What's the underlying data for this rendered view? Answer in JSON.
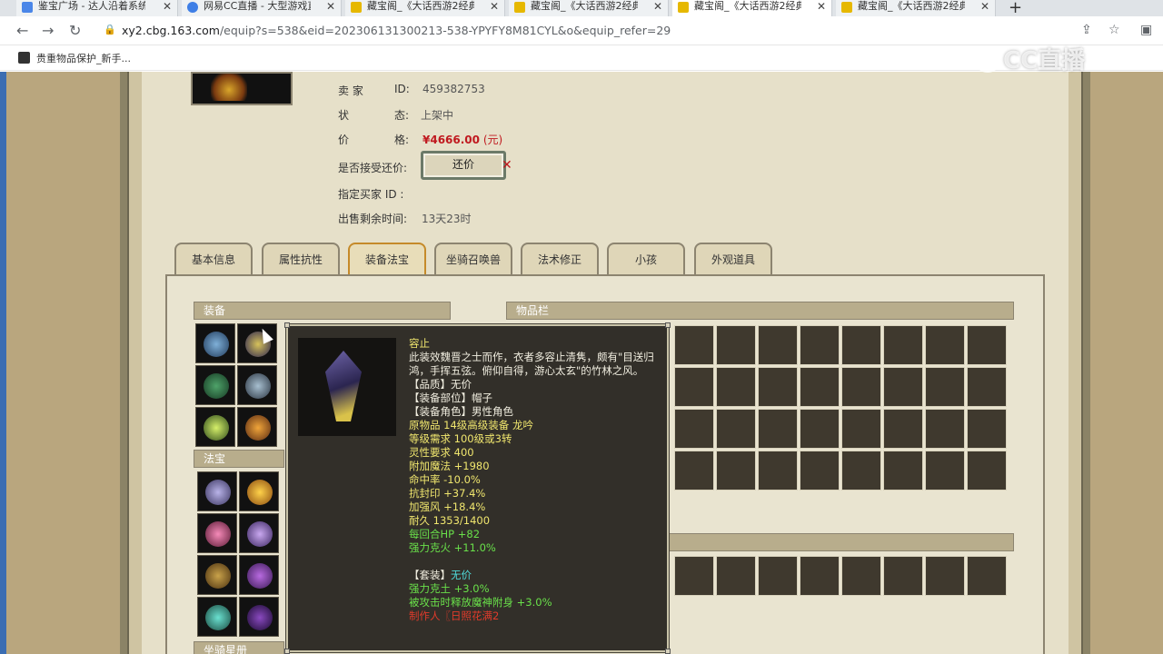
{
  "browser": {
    "tabs": [
      {
        "title": "鉴宝广场 - 达人沿着系统",
        "icon_color": "#4a86e8"
      },
      {
        "title": "网易CC直播 - 大型游戏直播",
        "icon_color": "#3f7fe6"
      },
      {
        "title": "藏宝阁_《大话西游2经典",
        "icon_color": "#e6b800"
      },
      {
        "title": "藏宝阁_《大话西游2经典",
        "icon_color": "#e6b800"
      },
      {
        "title": "藏宝阁_《大话西游2经典",
        "icon_color": "#e6b800"
      },
      {
        "title": "藏宝阁_《大话西游2经典",
        "icon_color": "#e6b800"
      }
    ],
    "active_tab": 4,
    "url_main": "xy2.cbg.163.com",
    "url_rest": "/equip?s=538&eid=202306131300213-538-YPYFY8M81CYL&o&equip_refer=29",
    "bookmark": "贵重物品保护_新手..."
  },
  "watermark": "CC直播",
  "seller": {
    "seller_label": "卖  家",
    "id_label": "ID:",
    "id_value": "459382753",
    "status_label": "状",
    "status_label2": "态:",
    "status_value": "上架中",
    "price_label": "价",
    "price_label2": "格:",
    "price_value": "¥4666.00",
    "price_unit": "(元)",
    "counter_label": "是否接受还价:",
    "counter_button": "还价",
    "buyer_label": "指定买家 ID :",
    "time_label": "出售剩余时间:",
    "time_value": "13天23时"
  },
  "tabs": [
    "基本信息",
    "属性抗性",
    "装备法宝",
    "坐骑召唤兽",
    "法术修正",
    "小孩",
    "外观道具"
  ],
  "active_tab_index": 2,
  "sections": {
    "equip": "装备",
    "fabao": "法宝",
    "inventory": "物品栏",
    "bottom_left": "坐骑星册"
  },
  "tooltip": {
    "name": "容止",
    "description": "此装效魏晋之士而作，衣者多容止清隽，颇有\"目送归鸿，手挥五弦。俯仰自得，游心太玄\"的竹林之风。",
    "quality": "【品质】无价",
    "slot": "【装备部位】帽子",
    "role": "【装备角色】男性角色",
    "original": "原物品 14级高级装备 龙吟",
    "level_req": "等级需求 100级或3转",
    "spirit_req": "灵性要求 400",
    "attr1": "附加魔法 +1980",
    "attr2": "命中率 -10.0%",
    "attr3": "抗封印 +37.4%",
    "attr4": "加强风 +18.4%",
    "durability": "耐久 1353/1400",
    "attr5": "每回合HP +82",
    "attr6": "强力克火 +11.0%",
    "set_label": "【套装】",
    "set_value": "无价",
    "set1": "强力克土 +3.0%",
    "set2": "被攻击时释放魔神附身 +3.0%",
    "maker": "制作人〖日照花满2"
  },
  "colors": {
    "tooltip_yellow": "#f0e66e",
    "tooltip_green": "#69e04a",
    "tooltip_cyan": "#4fd9d9",
    "tooltip_red": "#e03b2b",
    "price_red": "#c0191f"
  }
}
